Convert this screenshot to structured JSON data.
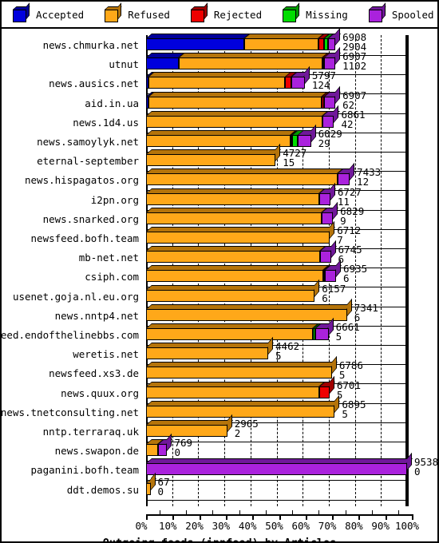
{
  "legend": {
    "items": [
      {
        "label": "Accepted",
        "color": "#0000dd",
        "icon": "cube-icon"
      },
      {
        "label": "Refused",
        "color": "#ffa819",
        "icon": "cube-icon"
      },
      {
        "label": "Rejected",
        "color": "#ee0000",
        "icon": "cube-icon"
      },
      {
        "label": "Missing",
        "color": "#00dd00",
        "icon": "cube-icon"
      },
      {
        "label": "Spooled",
        "color": "#aa22dd",
        "icon": "cube-icon"
      }
    ]
  },
  "axis": {
    "x_ticks": [
      "0%",
      "10%",
      "20%",
      "30%",
      "40%",
      "50%",
      "60%",
      "70%",
      "80%",
      "90%",
      "100%"
    ],
    "title": "Outgoing feeds (innfeed) by Articles"
  },
  "chart_data": {
    "type": "bar",
    "orientation": "horizontal",
    "stacked": true,
    "title": "Outgoing feeds (innfeed) by Articles",
    "xlabel": "",
    "ylabel": "",
    "xlim": [
      0,
      100
    ],
    "xunit": "percent",
    "grid": true,
    "legend_position": "top",
    "series_names": [
      "Accepted",
      "Refused",
      "Rejected",
      "Missing",
      "Spooled"
    ],
    "series_colors": [
      "#0000dd",
      "#ffa819",
      "#ee0000",
      "#00dd00",
      "#aa22dd"
    ],
    "categories": [
      "news.chmurka.net",
      "utnut",
      "news.ausics.net",
      "aid.in.ua",
      "news.1d4.us",
      "news.samoylyk.net",
      "eternal-september",
      "news.hispagatos.org",
      "i2pn.org",
      "news.snarked.org",
      "newsfeed.bofh.team",
      "mb-net.net",
      "csiph.com",
      "usenet.goja.nl.eu.org",
      "news.nntp4.net",
      "newsfeed.endofthelinebbs.com",
      "weretis.net",
      "newsfeed.xs3.de",
      "news.quux.org",
      "news.tnetconsulting.net",
      "nntp.terraraq.uk",
      "news.swapon.de",
      "paganini.bofh.team",
      "ddt.demos.su"
    ],
    "rows": [
      {
        "name": "news.chmurka.net",
        "labels": [
          "6908",
          "2904"
        ],
        "total_pct": 72.5,
        "segments": [
          {
            "s": "Accepted",
            "pct": 37.5
          },
          {
            "s": "Refused",
            "pct": 28.5
          },
          {
            "s": "Rejected",
            "pct": 2.2
          },
          {
            "s": "Missing",
            "pct": 1.5
          },
          {
            "s": "Spooled",
            "pct": 2.8
          }
        ]
      },
      {
        "name": "utnut",
        "labels": [
          "6907",
          "1102"
        ],
        "total_pct": 72.5,
        "segments": [
          {
            "s": "Accepted",
            "pct": 12.5
          },
          {
            "s": "Refused",
            "pct": 55.0
          },
          {
            "s": "Rejected",
            "pct": 0.8
          },
          {
            "s": "Spooled",
            "pct": 4.2
          }
        ]
      },
      {
        "name": "news.ausics.net",
        "labels": [
          "5797",
          "124"
        ],
        "total_pct": 60.8,
        "segments": [
          {
            "s": "Accepted",
            "pct": 0.8
          },
          {
            "s": "Refused",
            "pct": 52.5
          },
          {
            "s": "Rejected",
            "pct": 2.5
          },
          {
            "s": "Spooled",
            "pct": 5.0
          }
        ]
      },
      {
        "name": "aid.in.ua",
        "labels": [
          "6907",
          "62"
        ],
        "total_pct": 72.5,
        "segments": [
          {
            "s": "Accepted",
            "pct": 0.8
          },
          {
            "s": "Refused",
            "pct": 66.5
          },
          {
            "s": "Rejected",
            "pct": 1.0
          },
          {
            "s": "Spooled",
            "pct": 4.2
          }
        ]
      },
      {
        "name": "news.1d4.us",
        "labels": [
          "6861",
          "42"
        ],
        "total_pct": 72.0,
        "segments": [
          {
            "s": "Refused",
            "pct": 67.5
          },
          {
            "s": "Spooled",
            "pct": 4.5
          }
        ]
      },
      {
        "name": "news.samoylyk.net",
        "labels": [
          "6029",
          "29"
        ],
        "total_pct": 63.2,
        "segments": [
          {
            "s": "Refused",
            "pct": 55.2
          },
          {
            "s": "Rejected",
            "pct": 0.7
          },
          {
            "s": "Missing",
            "pct": 2.3
          },
          {
            "s": "Spooled",
            "pct": 5.0
          }
        ]
      },
      {
        "name": "eternal-september",
        "labels": [
          "4727",
          "15"
        ],
        "total_pct": 49.6,
        "segments": [
          {
            "s": "Refused",
            "pct": 49.6
          }
        ]
      },
      {
        "name": "news.hispagatos.org",
        "labels": [
          "7433",
          "12"
        ],
        "total_pct": 78.0,
        "segments": [
          {
            "s": "Refused",
            "pct": 73.5
          },
          {
            "s": "Spooled",
            "pct": 4.5
          }
        ]
      },
      {
        "name": "i2pn.org",
        "labels": [
          "6727",
          "11"
        ],
        "total_pct": 70.6,
        "segments": [
          {
            "s": "Refused",
            "pct": 66.4
          },
          {
            "s": "Spooled",
            "pct": 4.2
          }
        ]
      },
      {
        "name": "news.snarked.org",
        "labels": [
          "6829",
          "9"
        ],
        "total_pct": 71.6,
        "segments": [
          {
            "s": "Refused",
            "pct": 67.4
          },
          {
            "s": "Spooled",
            "pct": 4.2
          }
        ]
      },
      {
        "name": "newsfeed.bofh.team",
        "labels": [
          "6712",
          "7"
        ],
        "total_pct": 70.4,
        "segments": [
          {
            "s": "Refused",
            "pct": 70.4
          }
        ]
      },
      {
        "name": "mb-net.net",
        "labels": [
          "6745",
          "6"
        ],
        "total_pct": 70.8,
        "segments": [
          {
            "s": "Refused",
            "pct": 66.6
          },
          {
            "s": "Spooled",
            "pct": 4.2
          }
        ]
      },
      {
        "name": "csiph.com",
        "labels": [
          "6935",
          "6"
        ],
        "total_pct": 72.8,
        "segments": [
          {
            "s": "Refused",
            "pct": 67.8
          },
          {
            "s": "Rejected",
            "pct": 0.6
          },
          {
            "s": "Spooled",
            "pct": 4.4
          }
        ]
      },
      {
        "name": "usenet.goja.nl.eu.org",
        "labels": [
          "6157",
          "6"
        ],
        "total_pct": 64.6,
        "segments": [
          {
            "s": "Refused",
            "pct": 64.6
          }
        ]
      },
      {
        "name": "news.nntp4.net",
        "labels": [
          "7341",
          "6"
        ],
        "total_pct": 77.0,
        "segments": [
          {
            "s": "Refused",
            "pct": 77.0
          }
        ]
      },
      {
        "name": "newsfeed.endofthelinebbs.com",
        "labels": [
          "6661",
          "5"
        ],
        "total_pct": 69.9,
        "segments": [
          {
            "s": "Refused",
            "pct": 63.9
          },
          {
            "s": "Missing",
            "pct": 1.0
          },
          {
            "s": "Spooled",
            "pct": 5.0
          }
        ]
      },
      {
        "name": "weretis.net",
        "labels": [
          "4462",
          "5"
        ],
        "total_pct": 46.8,
        "segments": [
          {
            "s": "Refused",
            "pct": 46.8
          }
        ]
      },
      {
        "name": "newsfeed.xs3.de",
        "labels": [
          "6786",
          "5"
        ],
        "total_pct": 71.2,
        "segments": [
          {
            "s": "Refused",
            "pct": 71.2
          }
        ]
      },
      {
        "name": "news.quux.org",
        "labels": [
          "6701",
          "5"
        ],
        "total_pct": 70.3,
        "segments": [
          {
            "s": "Refused",
            "pct": 66.3
          },
          {
            "s": "Rejected",
            "pct": 4.0
          }
        ]
      },
      {
        "name": "news.tnetconsulting.net",
        "labels": [
          "6895",
          "5"
        ],
        "total_pct": 72.3,
        "segments": [
          {
            "s": "Refused",
            "pct": 72.3
          }
        ]
      },
      {
        "name": "nntp.terraraq.uk",
        "labels": [
          "2965",
          "2"
        ],
        "total_pct": 31.1,
        "segments": [
          {
            "s": "Refused",
            "pct": 31.1
          }
        ]
      },
      {
        "name": "news.swapon.de",
        "labels": [
          "769",
          "0"
        ],
        "total_pct": 8.1,
        "segments": [
          {
            "s": "Refused",
            "pct": 4.6
          },
          {
            "s": "Spooled",
            "pct": 3.5
          }
        ]
      },
      {
        "name": "paganini.bofh.team",
        "labels": [
          "9538",
          "0"
        ],
        "total_pct": 100.0,
        "segments": [
          {
            "s": "Spooled",
            "pct": 100.0
          }
        ]
      },
      {
        "name": "ddt.demos.su",
        "labels": [
          "67",
          "0"
        ],
        "total_pct": 1.7,
        "segments": [
          {
            "s": "Refused",
            "pct": 1.7
          }
        ]
      }
    ]
  }
}
